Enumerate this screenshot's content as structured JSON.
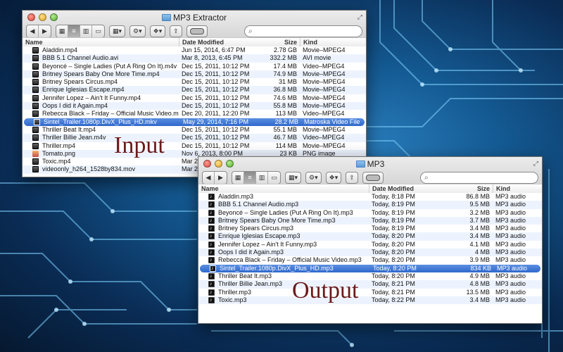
{
  "colors": {
    "selection": "#3a73d4",
    "alt_row": "#edf3fe",
    "overlay_text": "#6b1a1a"
  },
  "input_window": {
    "title": "MP3 Extractor",
    "columns": {
      "name": "Name",
      "date": "Date Modified",
      "size": "Size",
      "kind": "Kind"
    },
    "rows": [
      {
        "name": "Aladdin.mp4",
        "date": "Jun 15, 2014, 6:47 PM",
        "size": "2.78 GB",
        "kind": "Movie–MPEG4",
        "icon": "movie-file-icon"
      },
      {
        "name": "BBB 5.1 Channel Audio.avi",
        "date": "Mar 8, 2013, 6:45 PM",
        "size": "332.2 MB",
        "kind": "AVI movie",
        "icon": "movie-file-icon"
      },
      {
        "name": "Beyoncé – Single Ladies (Put A Ring On It).m4v",
        "date": "Dec 15, 2011, 10:12 PM",
        "size": "17.4 MB",
        "kind": "Video–MPEG4",
        "icon": "movie-file-icon"
      },
      {
        "name": "Britney Spears Baby One More Time.mp4",
        "date": "Dec 15, 2011, 10:12 PM",
        "size": "74.9 MB",
        "kind": "Movie–MPEG4",
        "icon": "movie-file-icon"
      },
      {
        "name": "Britney Spears Circus.mp4",
        "date": "Dec 15, 2011, 10:12 PM",
        "size": "31 MB",
        "kind": "Movie–MPEG4",
        "icon": "movie-file-icon"
      },
      {
        "name": "Enrique Iglesias Escape.mp4",
        "date": "Dec 15, 2011, 10:12 PM",
        "size": "36.8 MB",
        "kind": "Movie–MPEG4",
        "icon": "movie-file-icon"
      },
      {
        "name": "Jennifer Lopez – Ain't It Funny.mp4",
        "date": "Dec 15, 2011, 10:12 PM",
        "size": "74.6 MB",
        "kind": "Movie–MPEG4",
        "icon": "movie-file-icon"
      },
      {
        "name": "Oops I did it Again.mp4",
        "date": "Dec 15, 2011, 10:12 PM",
        "size": "55.8 MB",
        "kind": "Movie–MPEG4",
        "icon": "movie-file-icon"
      },
      {
        "name": "Rebecca Black – Friday – Official Music Video.m4v",
        "date": "Dec 20, 2011, 12:20 PM",
        "size": "113 MB",
        "kind": "Video–MPEG4",
        "icon": "movie-file-icon"
      },
      {
        "name": "Sintel_Trailer.1080p.DivX_Plus_HD.mkv",
        "date": "May 29, 2014, 7:16 PM",
        "size": "28.2 MB",
        "kind": "Matroska Video File",
        "icon": "movie-file-icon",
        "selected": true
      },
      {
        "name": "Thriller Beat It.mp4",
        "date": "Dec 15, 2011, 10:12 PM",
        "size": "55.1 MB",
        "kind": "Movie–MPEG4",
        "icon": "movie-file-icon"
      },
      {
        "name": "Thriller Billie Jean.m4v",
        "date": "Dec 15, 2011, 10:12 PM",
        "size": "46.7 MB",
        "kind": "Video–MPEG4",
        "icon": "movie-file-icon"
      },
      {
        "name": "Thriller.mp4",
        "date": "Dec 15, 2011, 10:12 PM",
        "size": "114 MB",
        "kind": "Movie–MPEG4",
        "icon": "movie-file-icon"
      },
      {
        "name": "Tomato.png",
        "date": "Nov 6, 2013, 8:00 PM",
        "size": "23 KB",
        "kind": "PNG image",
        "icon": "image-file-icon"
      },
      {
        "name": "Toxic.mp4",
        "date": "Mar 2,",
        "size": "",
        "kind": "",
        "icon": "movie-file-icon"
      },
      {
        "name": "videoonly_h264_1528by834.mov",
        "date": "Mar 2,",
        "size": "",
        "kind": "",
        "icon": "movie-file-icon"
      }
    ]
  },
  "output_window": {
    "title": "MP3",
    "columns": {
      "name": "Name",
      "date": "Date Modified",
      "size": "Size",
      "kind": "Kind"
    },
    "rows": [
      {
        "name": "Aladdin.mp3",
        "date": "Today, 8:18 PM",
        "size": "86.8 MB",
        "kind": "MP3 audio"
      },
      {
        "name": "BBB 5.1 Channel Audio.mp3",
        "date": "Today, 8:19 PM",
        "size": "9.5 MB",
        "kind": "MP3 audio"
      },
      {
        "name": "Beyoncé – Single Ladies (Put A Ring On It).mp3",
        "date": "Today, 8:19 PM",
        "size": "3.2 MB",
        "kind": "MP3 audio"
      },
      {
        "name": "Britney Spears Baby One More Time.mp3",
        "date": "Today, 8:19 PM",
        "size": "3.7 MB",
        "kind": "MP3 audio"
      },
      {
        "name": "Britney Spears Circus.mp3",
        "date": "Today, 8:19 PM",
        "size": "3.4 MB",
        "kind": "MP3 audio"
      },
      {
        "name": "Enrique Iglesias Escape.mp3",
        "date": "Today, 8:20 PM",
        "size": "3.4 MB",
        "kind": "MP3 audio"
      },
      {
        "name": "Jennifer Lopez – Ain't It Funny.mp3",
        "date": "Today, 8:20 PM",
        "size": "4.1 MB",
        "kind": "MP3 audio"
      },
      {
        "name": "Oops I did it Again.mp3",
        "date": "Today, 8:20 PM",
        "size": "4 MB",
        "kind": "MP3 audio"
      },
      {
        "name": "Rebecca Black – Friday – Official Music Video.mp3",
        "date": "Today, 8:20 PM",
        "size": "3.9 MB",
        "kind": "MP3 audio"
      },
      {
        "name": "Sintel_Trailer.1080p.DivX_Plus_HD.mp3",
        "date": "Today, 8:20 PM",
        "size": "834 KB",
        "kind": "MP3 audio",
        "selected": true
      },
      {
        "name": "Thriller Beat It.mp3",
        "date": "Today, 8:20 PM",
        "size": "4.9 MB",
        "kind": "MP3 audio"
      },
      {
        "name": "Thriller Billie Jean.mp3",
        "date": "Today, 8:21 PM",
        "size": "4.8 MB",
        "kind": "MP3 audio"
      },
      {
        "name": "Thriller.mp3",
        "date": "Today, 8:21 PM",
        "size": "13.5 MB",
        "kind": "MP3 audio"
      },
      {
        "name": "Toxic.mp3",
        "date": "Today, 8:22 PM",
        "size": "3.4 MB",
        "kind": "MP3 audio"
      }
    ]
  },
  "labels": {
    "input": "Input",
    "output": "Output"
  }
}
